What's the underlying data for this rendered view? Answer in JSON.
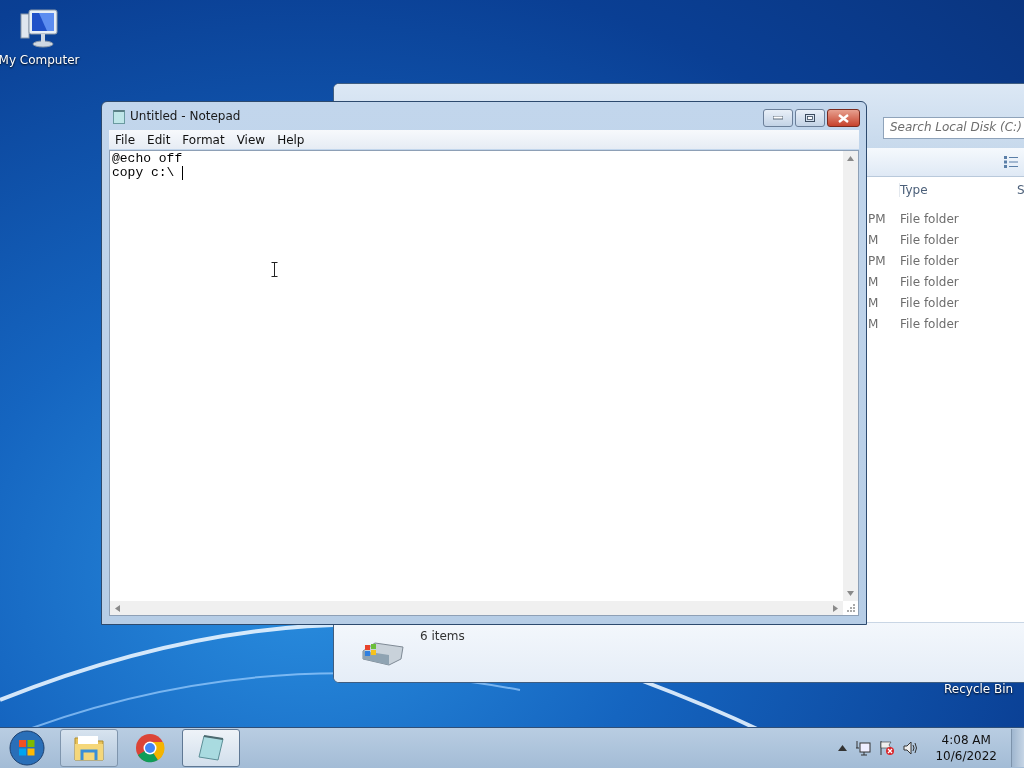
{
  "desktop": {
    "icons": [
      {
        "label": "My Computer"
      },
      {
        "label": "Recycle Bin"
      }
    ]
  },
  "explorer": {
    "search": {
      "placeholder": "Search Local Disk (C:)"
    },
    "columns": [
      "Type",
      "S"
    ],
    "rows": [
      {
        "column_1": "PM",
        "type": "File folder"
      },
      {
        "column_1": "M",
        "type": "File folder"
      },
      {
        "column_1": "PM",
        "type": "File folder"
      },
      {
        "column_1": "M",
        "type": "File folder"
      },
      {
        "column_1": "M",
        "type": "File folder"
      },
      {
        "column_1": "M",
        "type": "File folder"
      }
    ],
    "status": "6 items"
  },
  "notepad": {
    "title": "Untitled - Notepad",
    "menu": [
      "File",
      "Edit",
      "Format",
      "View",
      "Help"
    ],
    "lines": [
      "@echo off",
      "copy c:\\ "
    ]
  },
  "taskbar": {
    "apps": [
      {
        "kind": "explorer",
        "running": true,
        "selected": false
      },
      {
        "kind": "chrome",
        "running": false,
        "selected": false
      },
      {
        "kind": "notepad",
        "running": true,
        "selected": true
      }
    ],
    "time": "4:08 AM",
    "date": "10/6/2022"
  }
}
